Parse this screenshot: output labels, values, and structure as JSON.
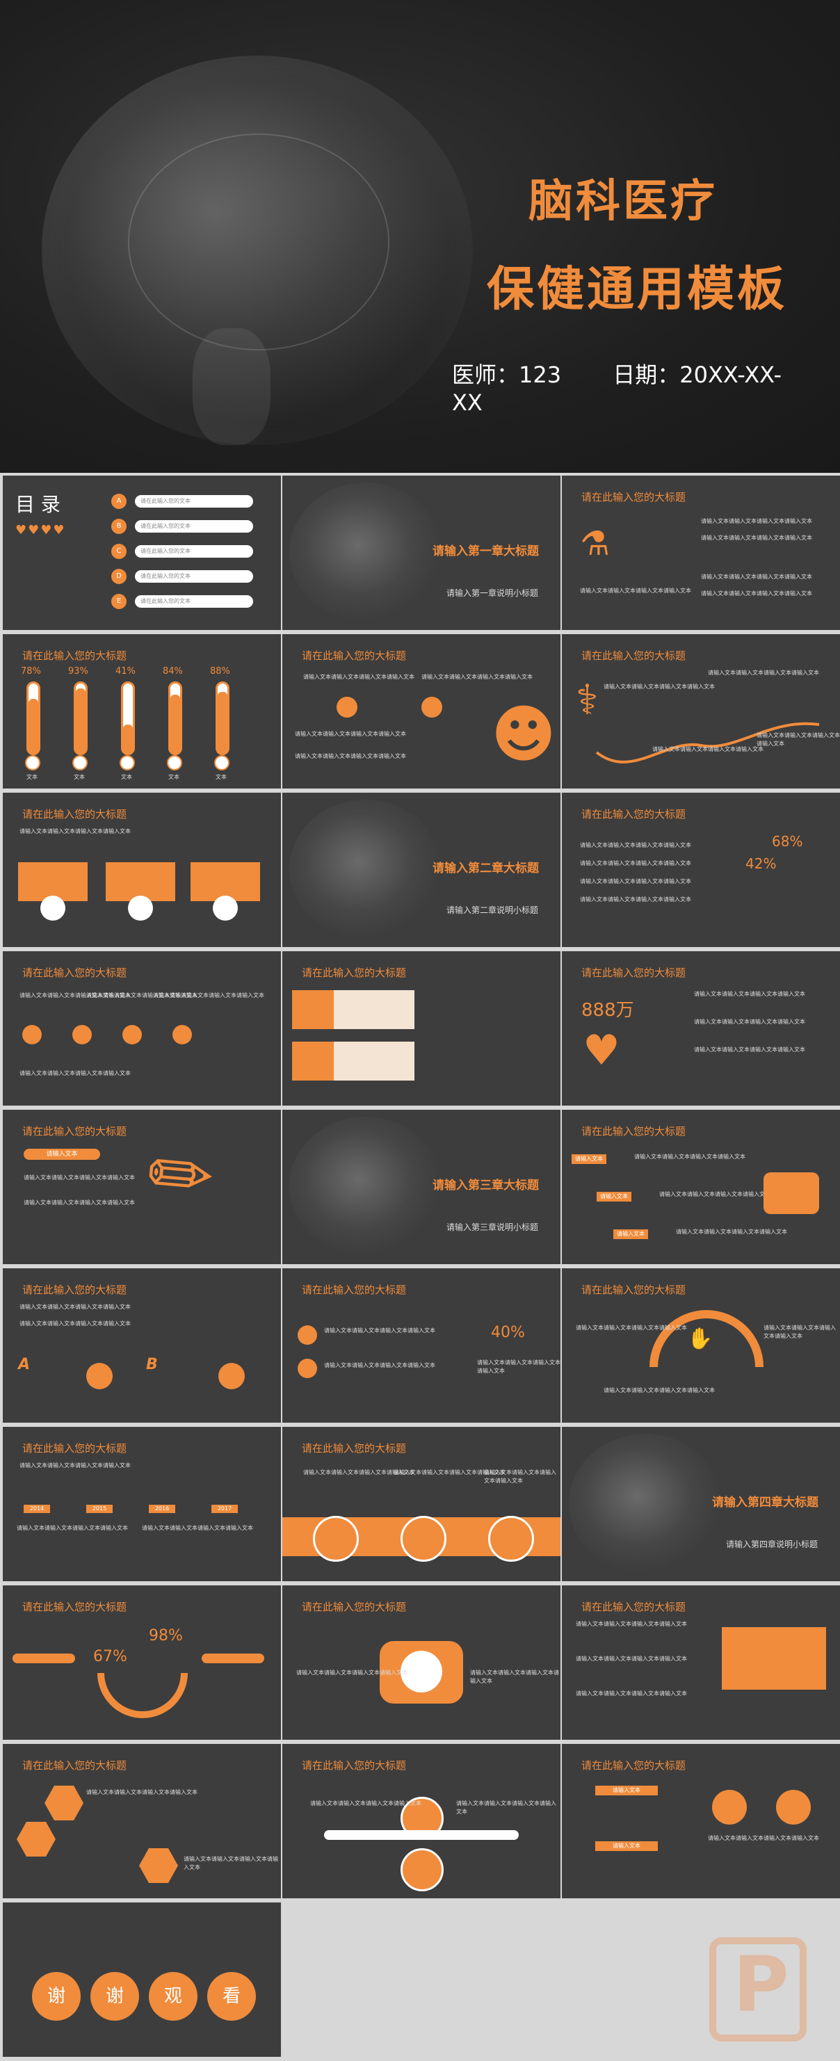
{
  "cover": {
    "title_line1": "脑科医疗",
    "title_line2": "保健通用模板",
    "doctor": "医师：123",
    "date": "日期：20XX-XX-XX"
  },
  "toc": {
    "title": "目 录",
    "letters": [
      "A",
      "B",
      "C",
      "D",
      "E"
    ],
    "items": [
      "请在此输入您的文本",
      "请在此输入您的文本",
      "请在此输入您的文本",
      "请在此输入您的文本",
      "请在此输入您的文本"
    ]
  },
  "slide_heading": "请在此输入您的大标题",
  "body_text": "请输入文本请输入文本请输入文本请输入文本",
  "short_text": "请输入文本",
  "chapters": [
    {
      "title": "请输入第一章大标题",
      "sub": "请输入第一章说明小标题"
    },
    {
      "title": "请输入第二章大标题",
      "sub": "请输入第二章说明小标题"
    },
    {
      "title": "请输入第三章大标题",
      "sub": "请输入第三章说明小标题"
    },
    {
      "title": "请输入第四章大标题",
      "sub": "请输入第四章说明小标题"
    }
  ],
  "thermo": {
    "labels": [
      "78%",
      "93%",
      "41%",
      "84%",
      "88%"
    ],
    "values": [
      78,
      93,
      41,
      84,
      88
    ],
    "caption": "文本"
  },
  "stats": {
    "p68": "68%",
    "p42": "42%",
    "big": "888万",
    "p40": "40%",
    "p67": "67%",
    "p98": "98%"
  },
  "years": [
    "2014",
    "2015",
    "2016",
    "2017"
  ],
  "ab": [
    "A",
    "B"
  ],
  "thanks": [
    "谢",
    "谢",
    "观",
    "看"
  ],
  "colors": {
    "accent": "#f08c3c",
    "slide_bg": "#3d3d3d",
    "page_bg": "#d7d7d7"
  }
}
